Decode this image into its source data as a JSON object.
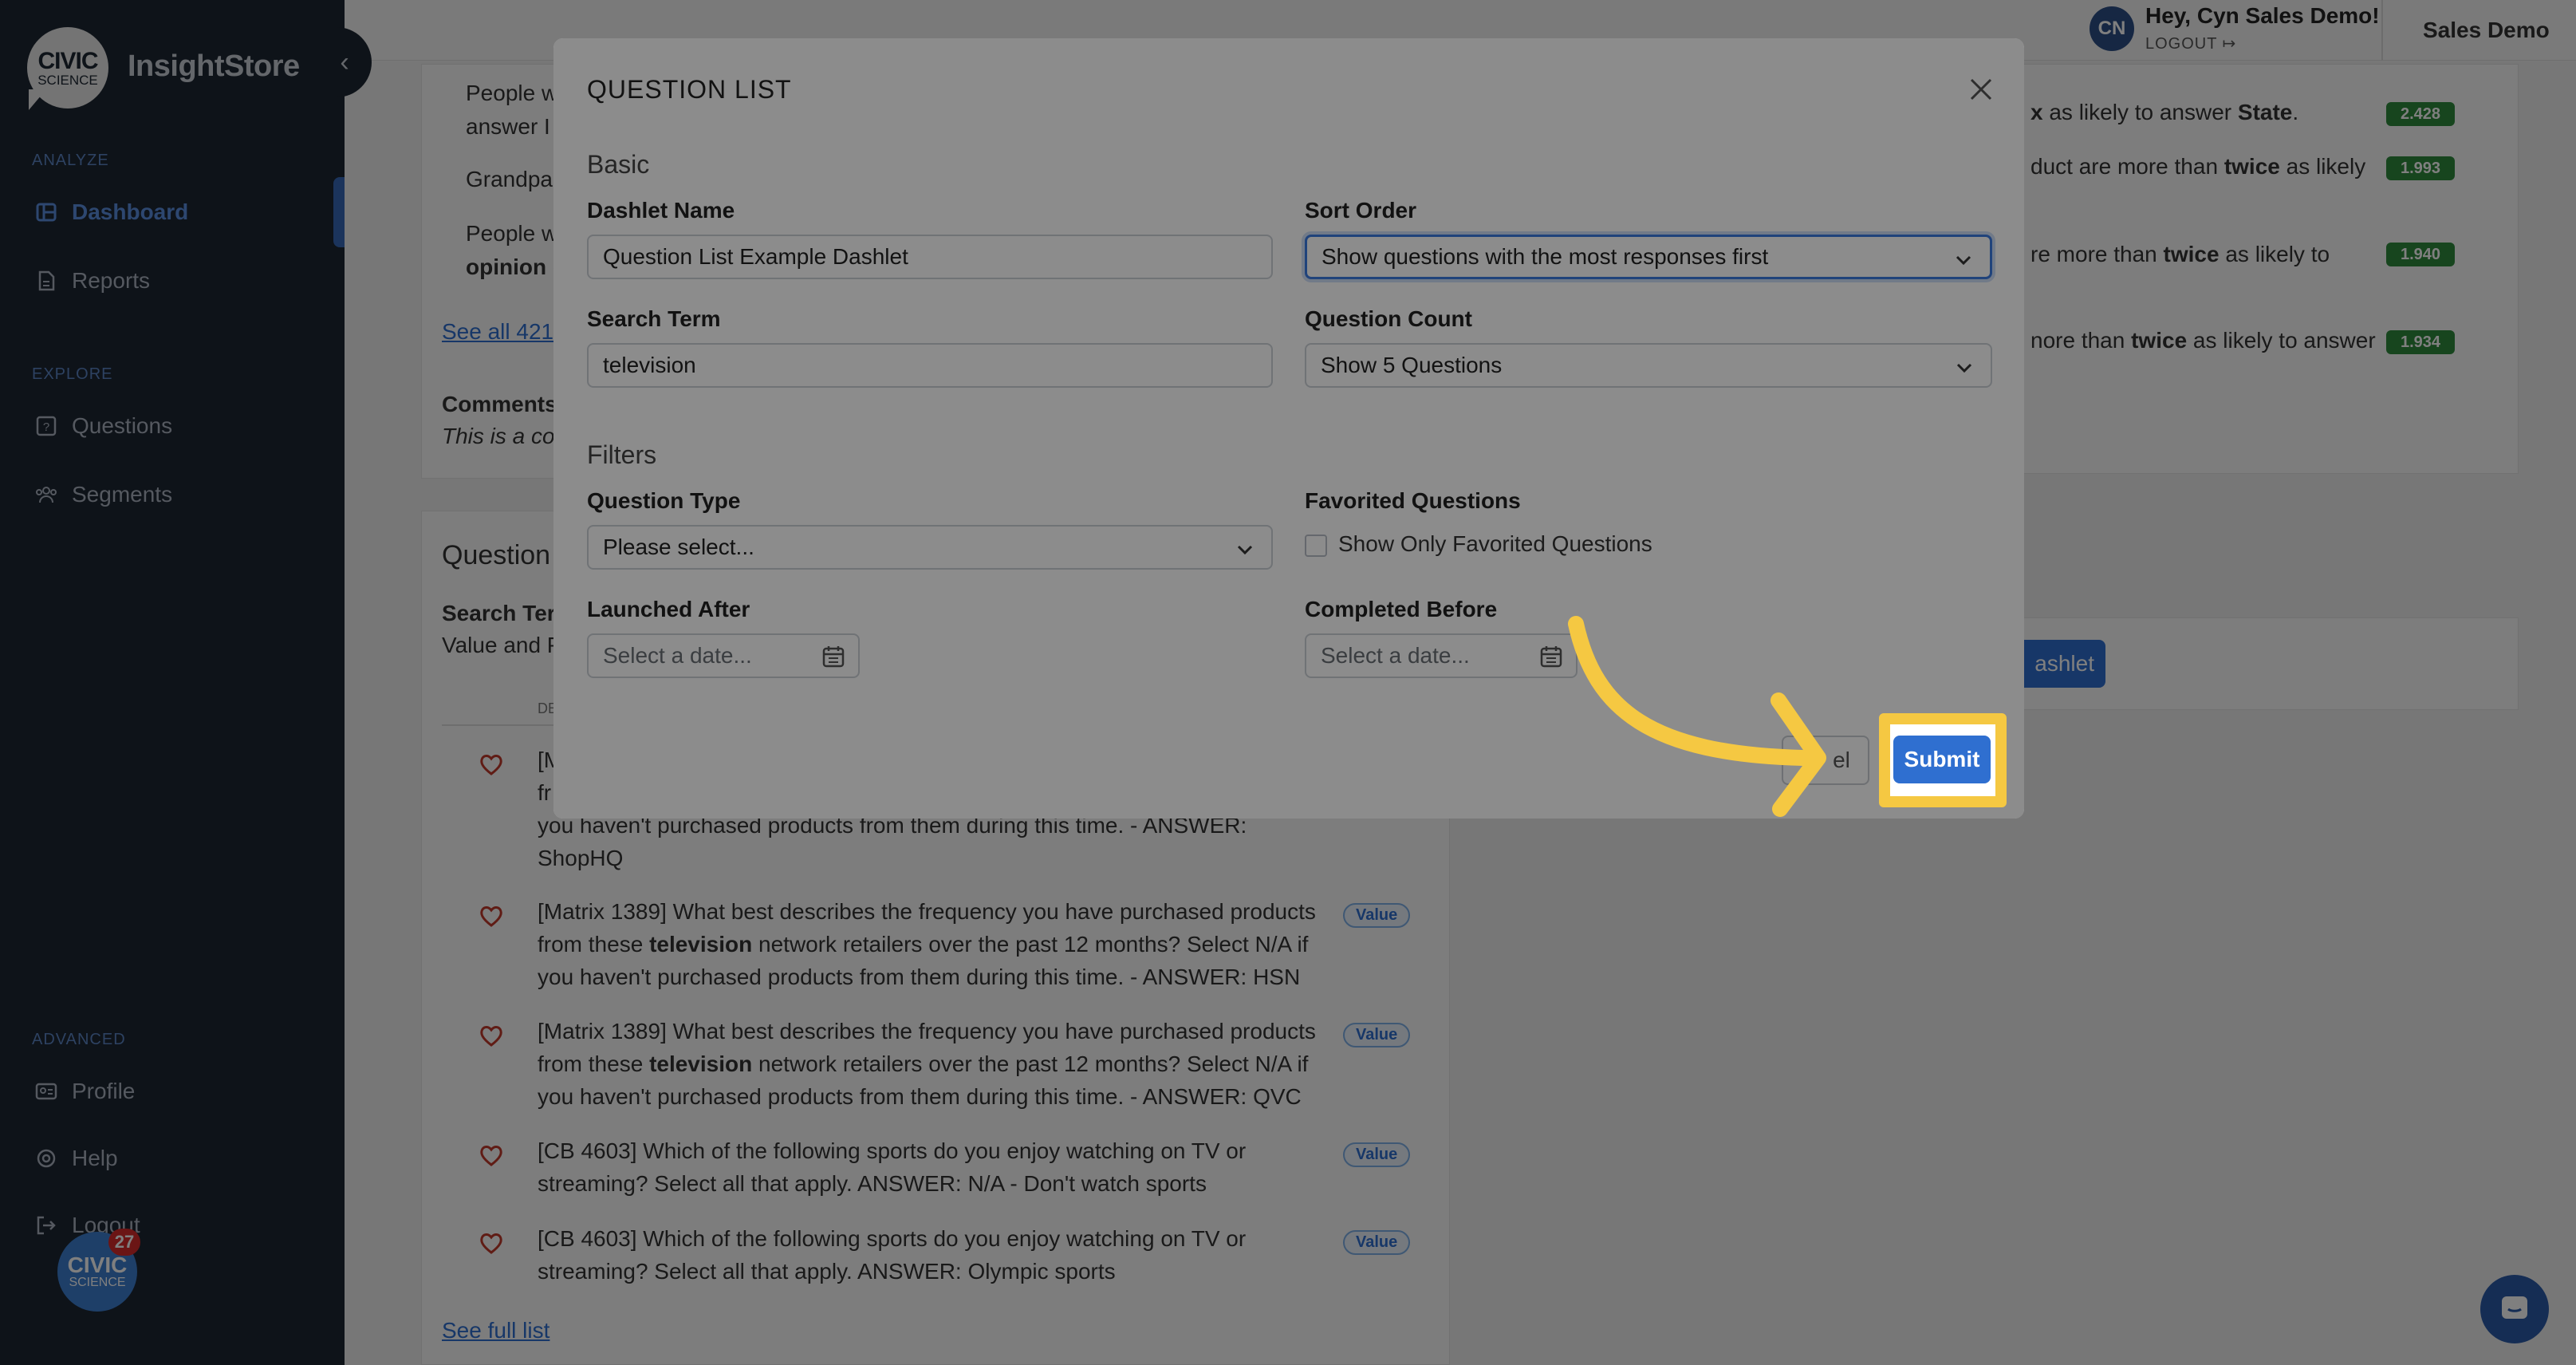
{
  "app": {
    "logo_line1": "CIVIC",
    "logo_line2": "SCIENCE",
    "brand": "InsightStore"
  },
  "sidebar": {
    "sections": {
      "analyze": "ANALYZE",
      "explore": "EXPLORE",
      "advanced": "ADVANCED"
    },
    "items": {
      "dashboard": "Dashboard",
      "reports": "Reports",
      "questions": "Questions",
      "segments": "Segments",
      "profile": "Profile",
      "help": "Help",
      "logout": "Logout"
    },
    "notification_count": "27"
  },
  "topbar": {
    "avatar_initials": "CN",
    "greeting": "Hey, Cyn Sales Demo!",
    "logout": "LOGOUT",
    "org": "Sales Demo"
  },
  "background": {
    "left_snippets": {
      "line1": "People w",
      "line2": "answer I",
      "line3": "Grandpar",
      "line4": "People w",
      "line5": "opinion c",
      "see_all": "See all 421",
      "comments_label": "Comments",
      "comments_text": "This is a co",
      "card_title": "Question",
      "search_term_label": "Search Ter",
      "value_and": "Value and P",
      "col_header": "DE"
    },
    "right_snippets": {
      "r1_prefix": "x",
      "r1_middle": " as likely to answer ",
      "r1_bold": "State",
      "r1_suffix": ".",
      "r2_text": "duct are more than ",
      "r2_bold": "twice",
      "r2_suffix": " as likely",
      "r3_text": "re more than ",
      "r3_bold": "twice",
      "r3_suffix": " as likely to",
      "r4_text": "nore than ",
      "r4_bold": "twice",
      "r4_suffix": " as likely to answer",
      "scores": [
        "2.428",
        "1.993",
        "1.940",
        "1.934"
      ],
      "add_dashlet": "ashlet"
    },
    "partial_row": {
      "line1": "[M",
      "line2": "fr",
      "line3": "you haven't purchased products from them during this time. - ANSWER:",
      "line4": "ShopHQ"
    },
    "question_rows": [
      {
        "part1": "[Matrix 1389] What best describes the frequency you have purchased products from these ",
        "bold": "television",
        "part2": " network retailers over the past 12 months? Select N/A if you haven't purchased products from them during this time. - ANSWER: HSN",
        "badge": "Value"
      },
      {
        "part1": "[Matrix 1389] What best describes the frequency you have purchased products from these ",
        "bold": "television",
        "part2": " network retailers over the past 12 months? Select N/A if you haven't purchased products from them during this time. - ANSWER: QVC",
        "badge": "Value"
      },
      {
        "part1": "[CB 4603] Which of the following sports do you enjoy watching on TV or streaming? Select all that apply. ANSWER: N/A - Don't watch sports",
        "bold": "",
        "part2": "",
        "badge": "Value"
      },
      {
        "part1": "[CB 4603] Which of the following sports do you enjoy watching on TV or streaming? Select all that apply. ANSWER: Olympic sports",
        "bold": "",
        "part2": "",
        "badge": "Value"
      }
    ],
    "see_full_list": "See full list"
  },
  "modal": {
    "title": "QUESTION LIST",
    "section_basic": "Basic",
    "section_filters": "Filters",
    "dashlet_name_label": "Dashlet Name",
    "dashlet_name_value": "Question List Example Dashlet",
    "sort_order_label": "Sort Order",
    "sort_order_value": "Show questions with the most responses first",
    "search_term_label": "Search Term",
    "search_term_value": "television",
    "question_count_label": "Question Count",
    "question_count_value": "Show 5 Questions",
    "question_type_label": "Question Type",
    "question_type_value": "Please select...",
    "favorited_label": "Favorited Questions",
    "favorited_checkbox_label": "Show Only Favorited Questions",
    "launched_after_label": "Launched After",
    "launched_after_placeholder": "Select a date...",
    "completed_before_label": "Completed Before",
    "completed_before_placeholder": "Select a date...",
    "cancel_label": "el",
    "submit_label": "Submit"
  },
  "colors": {
    "sidebar_bg": "#1d2632",
    "accent": "#2f6fd0",
    "highlight": "#f5c842",
    "score_green": "#2f8a3c"
  }
}
